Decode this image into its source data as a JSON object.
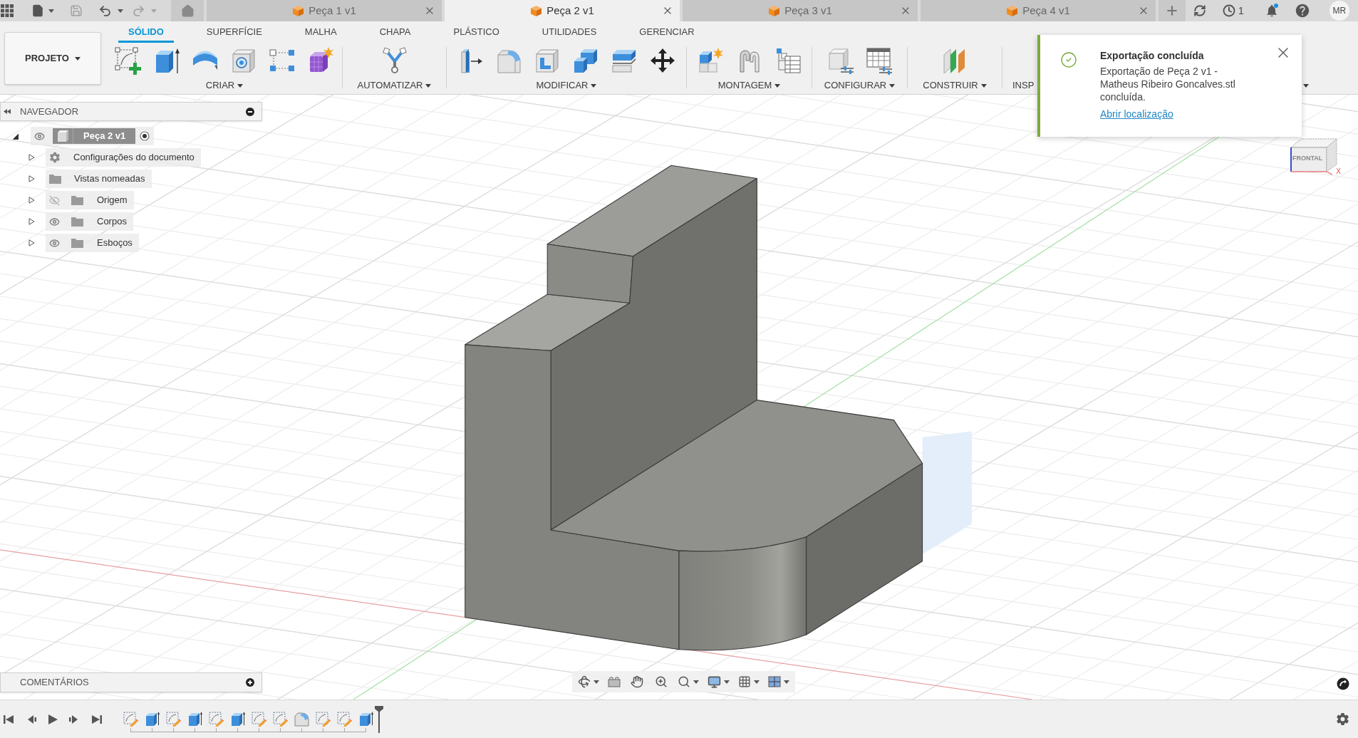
{
  "quick_access": {
    "save": {
      "disabled": true
    },
    "undo": {
      "disabled": false
    },
    "redo": {
      "disabled": true
    }
  },
  "document_tabs": [
    {
      "label": "Peça 1 v1",
      "selected": false
    },
    {
      "label": "Peça 2 v1",
      "selected": true
    },
    {
      "label": "Peça 3 v1",
      "selected": false
    },
    {
      "label": "Peça 4 v1",
      "selected": false
    }
  ],
  "header_right": {
    "job_count": "1",
    "bell_badge": true,
    "avatar_initials": "MR"
  },
  "toolbar": {
    "project_button": "PROJETO",
    "tabs": [
      {
        "label": "SÓLIDO",
        "selected": true
      },
      {
        "label": "SUPERFÍCIE",
        "selected": false
      },
      {
        "label": "MALHA",
        "selected": false
      },
      {
        "label": "CHAPA",
        "selected": false
      },
      {
        "label": "PLÁSTICO",
        "selected": false
      },
      {
        "label": "UTILIDADES",
        "selected": false
      },
      {
        "label": "GERENCIAR",
        "selected": false
      }
    ],
    "groups": [
      {
        "label": "CRIAR",
        "menu": true
      },
      {
        "label": "AUTOMATIZAR",
        "menu": true
      },
      {
        "label": "MODIFICAR",
        "menu": true
      },
      {
        "label": "MONTAGEM",
        "menu": true
      },
      {
        "label": "CONFIGURAR",
        "menu": true
      },
      {
        "label": "CONSTRUIR",
        "menu": true
      },
      {
        "label": "INSP",
        "menu": false
      }
    ]
  },
  "notification": {
    "title": "Exportação concluída",
    "message": "Exportação de Peça 2 v1 - Matheus Ribeiro Goncalves.stl concluída.",
    "link": "Abrir localização"
  },
  "navigator": {
    "title": "NAVEGADOR",
    "root": {
      "label": "Peça 2 v1",
      "expanded": true,
      "visible": true,
      "active": true,
      "children": [
        {
          "label": "Configurações do documento",
          "kind": "settings",
          "expanded": false
        },
        {
          "label": "Vistas nomeadas",
          "kind": "folder",
          "expanded": false
        },
        {
          "label": "Origem",
          "kind": "folder",
          "expanded": false,
          "visible": false
        },
        {
          "label": "Corpos",
          "kind": "folder",
          "expanded": false,
          "visible": true
        },
        {
          "label": "Esboços",
          "kind": "folder",
          "expanded": false,
          "visible": true
        }
      ]
    }
  },
  "view_cube": {
    "face_label": "FRONTAL",
    "axis_label": "X"
  },
  "comments": {
    "title": "COMENTÁRIOS"
  },
  "timeline": {
    "features": [
      {
        "kind": "sketch"
      },
      {
        "kind": "extrude"
      },
      {
        "kind": "sketch"
      },
      {
        "kind": "extrude"
      },
      {
        "kind": "sketch"
      },
      {
        "kind": "extrude"
      },
      {
        "kind": "sketch"
      },
      {
        "kind": "sketch"
      },
      {
        "kind": "fillet"
      },
      {
        "kind": "sketch"
      },
      {
        "kind": "sketch"
      },
      {
        "kind": "extrude"
      }
    ]
  }
}
